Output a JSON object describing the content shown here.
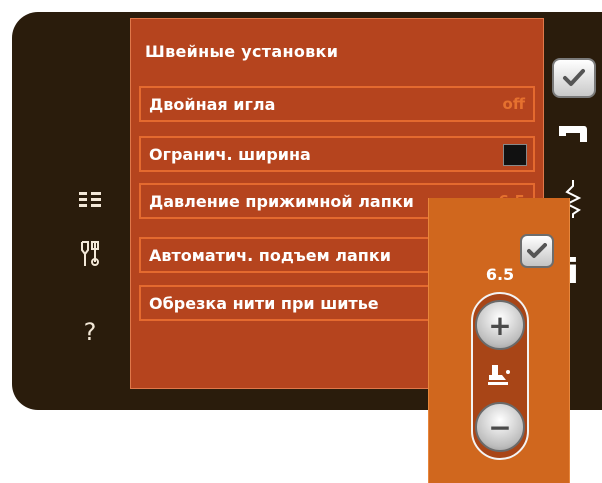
{
  "left_rail": {
    "items": [
      {
        "icon": "list-icon"
      },
      {
        "icon": "tools-icon"
      },
      {
        "icon": "help-icon",
        "label": "?"
      }
    ]
  },
  "panel": {
    "title": "Швейные установки",
    "rows": [
      {
        "label": "Двойная игла",
        "value": "off"
      },
      {
        "label": "Огранич. ширина",
        "checkbox": "unchecked"
      },
      {
        "label": "Давление прижимной лапки",
        "value": "6.5"
      },
      {
        "label": "Автоматич. подъем лапки"
      },
      {
        "label": "Обрезка нити при шитье"
      }
    ]
  },
  "right_strip": {
    "items": [
      {
        "icon": "checkmark-icon"
      },
      {
        "icon": "sewing-machine-icon"
      },
      {
        "icon": "stitch-zigzag-icon"
      },
      {
        "icon": "info-icon",
        "label": "i"
      }
    ]
  },
  "popup": {
    "value": "6.5",
    "plus_label": "+",
    "minus_label": "−",
    "icon": "presser-foot-icon"
  },
  "colors": {
    "panel_bg": "#b5441e",
    "row_border": "#e46a2f",
    "popup_bg": "#d0671e",
    "device_bg": "#2a1c0c"
  }
}
